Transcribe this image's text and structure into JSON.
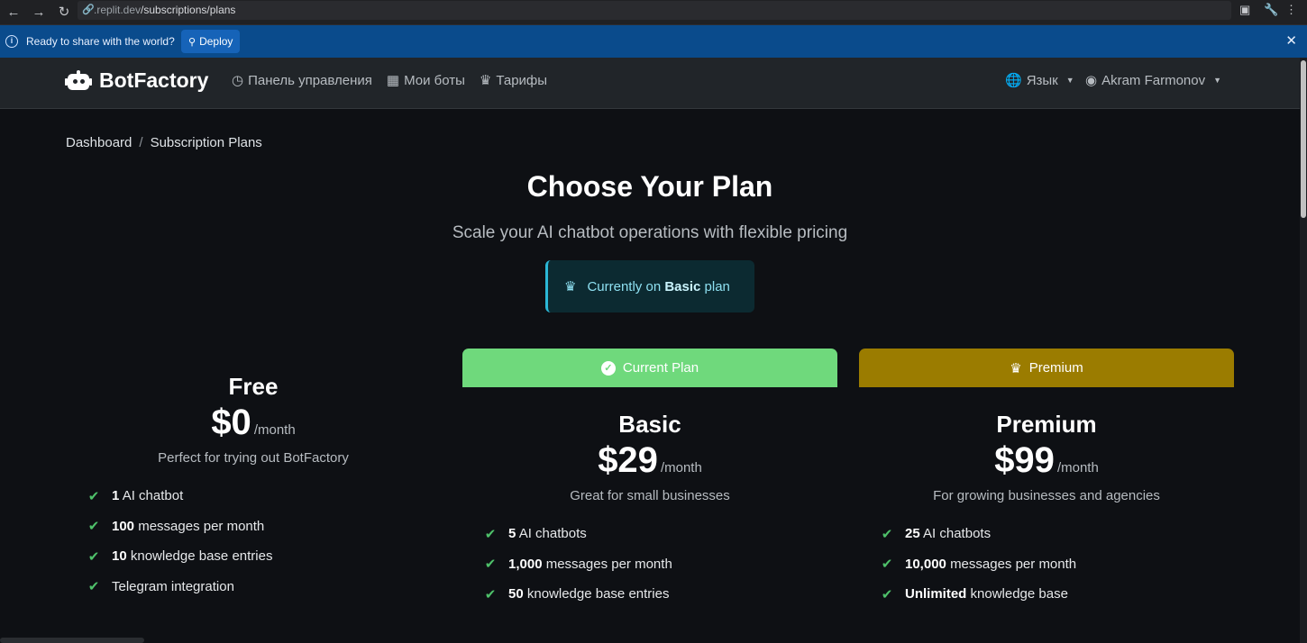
{
  "browser": {
    "url_prefix": ".replit.dev",
    "url_path": "/subscriptions/plans"
  },
  "announcement": {
    "message": "Ready to share with the world?",
    "deploy_label": "Deploy"
  },
  "navbar": {
    "brand": "BotFactory",
    "links": [
      {
        "label": "Панель управления",
        "icon": "speedometer-icon"
      },
      {
        "label": "Мои боты",
        "icon": "robot-icon"
      },
      {
        "label": "Тарифы",
        "icon": "crown-icon"
      }
    ],
    "language_label": "Язык",
    "user_name": "Akram Farmonov"
  },
  "breadcrumb": {
    "items": [
      "Dashboard",
      "Subscription Plans"
    ]
  },
  "hero": {
    "title": "Choose Your Plan",
    "subtitle": "Scale your AI chatbot operations with flexible pricing"
  },
  "current_plan_notice": {
    "prefix": "Currently on",
    "plan": "Basic",
    "suffix": "plan"
  },
  "colors": {
    "current_plan_header": "#6fd97c",
    "premium_header": "#9b7c00",
    "check": "#4ec16a",
    "alert_border": "#2bb7d6"
  },
  "plans": [
    {
      "header": "",
      "name": "Free",
      "price": "$0",
      "per": "/month",
      "description": "Perfect for trying out BotFactory",
      "features": [
        {
          "bold": "1",
          "text": "AI chatbot"
        },
        {
          "bold": "100",
          "text": "messages per month"
        },
        {
          "bold": "10",
          "text": "knowledge base entries"
        },
        {
          "bold": "",
          "text": "Telegram integration"
        }
      ]
    },
    {
      "header": "Current Plan",
      "header_icon": "check-circle-icon",
      "name": "Basic",
      "price": "$29",
      "per": "/month",
      "description": "Great for small businesses",
      "features": [
        {
          "bold": "5",
          "text": "AI chatbots"
        },
        {
          "bold": "1,000",
          "text": "messages per month"
        },
        {
          "bold": "50",
          "text": "knowledge base entries"
        }
      ]
    },
    {
      "header": "Premium",
      "header_icon": "crown-icon",
      "name": "Premium",
      "price": "$99",
      "per": "/month",
      "description": "For growing businesses and agencies",
      "features": [
        {
          "bold": "25",
          "text": "AI chatbots"
        },
        {
          "bold": "10,000",
          "text": "messages per month"
        },
        {
          "bold": "Unlimited",
          "text": "knowledge base"
        }
      ]
    }
  ]
}
